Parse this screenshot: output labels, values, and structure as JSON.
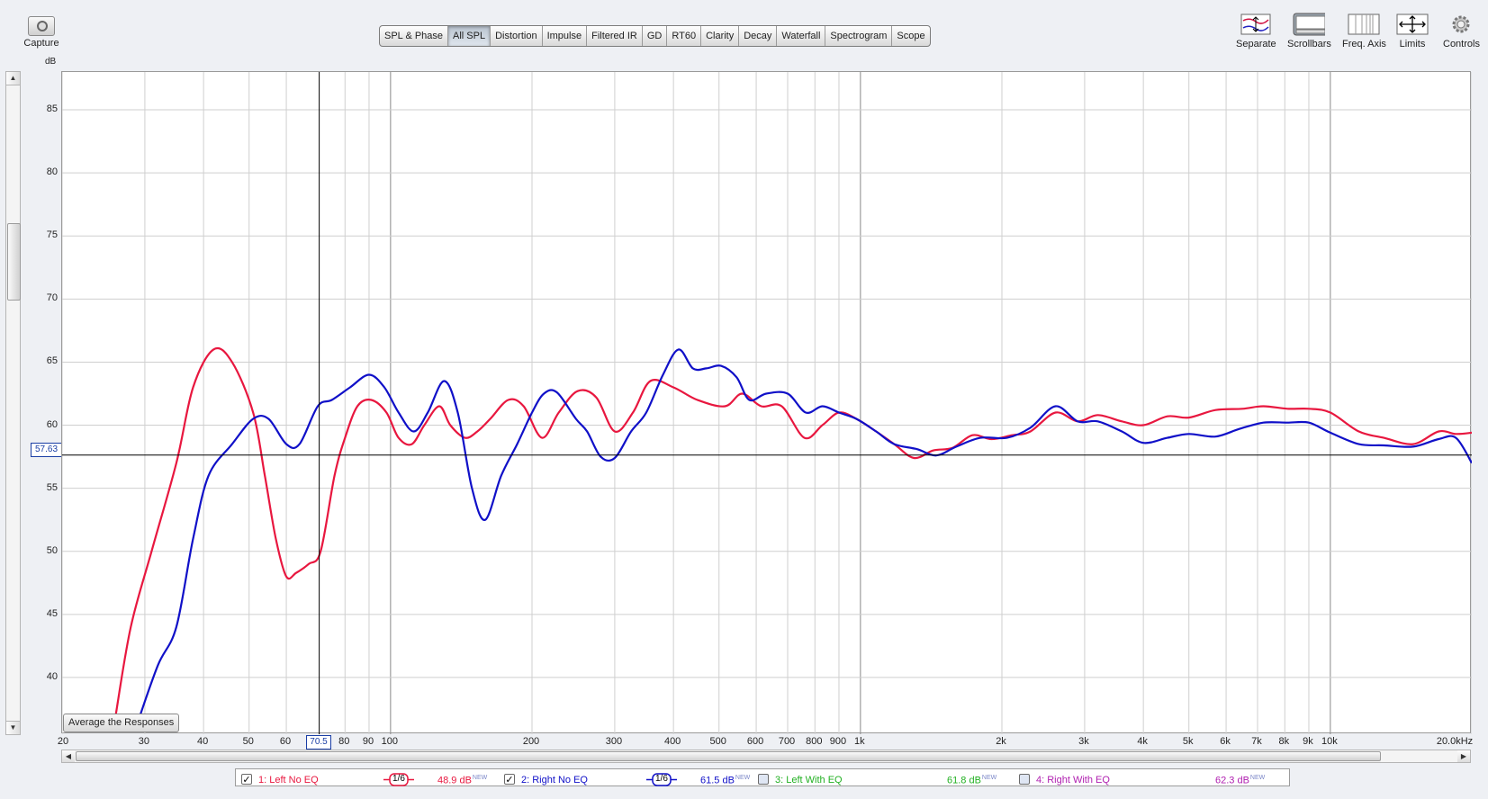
{
  "toolbar": {
    "capture_label": "Capture",
    "capture_icon": "camera-icon",
    "tabs": [
      "SPL & Phase",
      "All SPL",
      "Distortion",
      "Impulse",
      "Filtered IR",
      "GD",
      "RT60",
      "Clarity",
      "Decay",
      "Waterfall",
      "Spectrogram",
      "Scope"
    ],
    "active_tab": "All SPL",
    "right_tools": [
      {
        "label": "Separate",
        "icon": "separate-traces-icon"
      },
      {
        "label": "Scrollbars",
        "icon": "scrollbars-icon"
      },
      {
        "label": "Freq. Axis",
        "icon": "freq-axis-icon"
      },
      {
        "label": "Limits",
        "icon": "limits-icon"
      },
      {
        "label": "Controls",
        "icon": "gear-icon"
      }
    ]
  },
  "y_unit": "dB",
  "cursor": {
    "y_value": "57.63",
    "x_value": "70.5"
  },
  "average_button": "Average the Responses",
  "colors": {
    "left_no_eq": "#e8173f",
    "right_no_eq": "#1010c8",
    "left_with_eq": "#22b022",
    "right_with_eq": "#b020b0",
    "grid": "#cccccc",
    "cursor": "#000000"
  },
  "chart_data": {
    "type": "line",
    "xscale": "log",
    "xlim": [
      20,
      20000
    ],
    "ylim": [
      35.5,
      88
    ],
    "y_ticks": [
      40,
      45,
      50,
      55,
      60,
      65,
      70,
      75,
      80,
      85
    ],
    "y_tick_labels": [
      "40",
      "45",
      "50",
      "55",
      "60",
      "65",
      "70",
      "75",
      "80",
      "85"
    ],
    "x_ticks": [
      20,
      30,
      40,
      50,
      60,
      80,
      90,
      100,
      200,
      300,
      400,
      500,
      600,
      700,
      800,
      900,
      1000,
      2000,
      3000,
      4000,
      5000,
      6000,
      7000,
      8000,
      9000,
      10000,
      20000
    ],
    "x_tick_labels": [
      "20",
      "30",
      "40",
      "50",
      "60",
      "80",
      "90",
      "100",
      "200",
      "300",
      "400",
      "500",
      "600",
      "700",
      "800",
      "900",
      "1k",
      "2k",
      "3k",
      "4k",
      "5k",
      "6k",
      "7k",
      "8k",
      "9k",
      "10k",
      "20.0kHz"
    ],
    "grid": true,
    "series": [
      {
        "name": "1: Left No EQ",
        "color": "#e8173f",
        "points": [
          [
            26,
            37
          ],
          [
            28,
            44
          ],
          [
            31,
            50
          ],
          [
            35,
            57
          ],
          [
            38,
            63
          ],
          [
            42,
            66
          ],
          [
            46,
            65
          ],
          [
            51,
            61
          ],
          [
            54,
            56
          ],
          [
            57,
            51
          ],
          [
            60,
            48
          ],
          [
            63,
            48.3
          ],
          [
            67,
            49
          ],
          [
            71,
            50
          ],
          [
            76,
            56
          ],
          [
            80,
            59
          ],
          [
            85,
            61.5
          ],
          [
            91,
            62
          ],
          [
            98,
            61
          ],
          [
            104,
            59
          ],
          [
            111,
            58.5
          ],
          [
            118,
            60
          ],
          [
            127,
            61.5
          ],
          [
            134,
            60
          ],
          [
            144,
            59
          ],
          [
            153,
            59.5
          ],
          [
            163,
            60.5
          ],
          [
            178,
            62
          ],
          [
            192,
            61.5
          ],
          [
            210,
            59
          ],
          [
            228,
            61
          ],
          [
            250,
            62.7
          ],
          [
            274,
            62.2
          ],
          [
            300,
            59.5
          ],
          [
            328,
            61
          ],
          [
            357,
            63.5
          ],
          [
            400,
            63
          ],
          [
            450,
            62
          ],
          [
            515,
            61.5
          ],
          [
            560,
            62.5
          ],
          [
            615,
            61.5
          ],
          [
            680,
            61.5
          ],
          [
            760,
            59
          ],
          [
            830,
            60
          ],
          [
            900,
            61
          ],
          [
            980,
            60.5
          ],
          [
            1080,
            59.5
          ],
          [
            1180,
            58.5
          ],
          [
            1300,
            57.4
          ],
          [
            1430,
            58
          ],
          [
            1570,
            58.2
          ],
          [
            1730,
            59.2
          ],
          [
            1900,
            58.9
          ],
          [
            2100,
            59.2
          ],
          [
            2300,
            59.5
          ],
          [
            2600,
            61
          ],
          [
            2900,
            60.3
          ],
          [
            3200,
            60.8
          ],
          [
            3600,
            60.3
          ],
          [
            4000,
            60
          ],
          [
            4500,
            60.7
          ],
          [
            5000,
            60.6
          ],
          [
            5700,
            61.2
          ],
          [
            6500,
            61.3
          ],
          [
            7200,
            61.5
          ],
          [
            8100,
            61.3
          ],
          [
            9000,
            61.3
          ],
          [
            10000,
            61
          ],
          [
            11500,
            59.5
          ],
          [
            13000,
            59
          ],
          [
            15000,
            58.5
          ],
          [
            17000,
            59.5
          ],
          [
            18500,
            59.3
          ],
          [
            20000,
            59.4
          ]
        ]
      },
      {
        "name": "2: Right No EQ",
        "color": "#1010c8",
        "points": [
          [
            29,
            36.5
          ],
          [
            32,
            41
          ],
          [
            35,
            44
          ],
          [
            38,
            51
          ],
          [
            41,
            56
          ],
          [
            46,
            58.5
          ],
          [
            51,
            60.5
          ],
          [
            55,
            60.5
          ],
          [
            60,
            58.5
          ],
          [
            64,
            58.5
          ],
          [
            70,
            61.5
          ],
          [
            75,
            62
          ],
          [
            82,
            63
          ],
          [
            90,
            64
          ],
          [
            97,
            63
          ],
          [
            104,
            61
          ],
          [
            112,
            59.5
          ],
          [
            120,
            61
          ],
          [
            130,
            63.5
          ],
          [
            139,
            61
          ],
          [
            149,
            55
          ],
          [
            159,
            52.5
          ],
          [
            172,
            56
          ],
          [
            186,
            58.5
          ],
          [
            200,
            61
          ],
          [
            212,
            62.5
          ],
          [
            226,
            62.6
          ],
          [
            248,
            60.5
          ],
          [
            262,
            59.5
          ],
          [
            280,
            57.5
          ],
          [
            300,
            57.4
          ],
          [
            325,
            59.5
          ],
          [
            350,
            61
          ],
          [
            380,
            64
          ],
          [
            410,
            66
          ],
          [
            440,
            64.5
          ],
          [
            470,
            64.5
          ],
          [
            505,
            64.7
          ],
          [
            545,
            63.8
          ],
          [
            580,
            62
          ],
          [
            630,
            62.5
          ],
          [
            700,
            62.5
          ],
          [
            765,
            61
          ],
          [
            830,
            61.5
          ],
          [
            900,
            61
          ],
          [
            980,
            60.5
          ],
          [
            1080,
            59.5
          ],
          [
            1180,
            58.5
          ],
          [
            1320,
            58.1
          ],
          [
            1450,
            57.6
          ],
          [
            1600,
            58.3
          ],
          [
            1800,
            59
          ],
          [
            2050,
            59
          ],
          [
            2300,
            59.8
          ],
          [
            2600,
            61.5
          ],
          [
            2900,
            60.3
          ],
          [
            3200,
            60.3
          ],
          [
            3600,
            59.5
          ],
          [
            4000,
            58.6
          ],
          [
            4500,
            59
          ],
          [
            5000,
            59.3
          ],
          [
            5700,
            59.1
          ],
          [
            6400,
            59.7
          ],
          [
            7200,
            60.2
          ],
          [
            8100,
            60.2
          ],
          [
            9000,
            60.2
          ],
          [
            10000,
            59.4
          ],
          [
            11500,
            58.5
          ],
          [
            13000,
            58.4
          ],
          [
            15000,
            58.3
          ],
          [
            17000,
            58.9
          ],
          [
            18500,
            59
          ],
          [
            20000,
            57
          ]
        ]
      },
      {
        "name": "3: Left With EQ",
        "color": "#22b022",
        "points": []
      },
      {
        "name": "4: Right With EQ",
        "color": "#b020b0",
        "points": []
      }
    ]
  },
  "legend": [
    {
      "name": "1: Left No EQ",
      "checked": true,
      "smoothing": "1/6",
      "value": "48.9 dB",
      "tag": "NEW",
      "color": "#e8173f"
    },
    {
      "name": "2: Right No EQ",
      "checked": true,
      "smoothing": "1/6",
      "value": "61.5 dB",
      "tag": "NEW",
      "color": "#1010c8"
    },
    {
      "name": "3: Left With EQ",
      "checked": false,
      "smoothing": "",
      "value": "61.8 dB",
      "tag": "NEW",
      "color": "#22b022"
    },
    {
      "name": "4: Right With EQ",
      "checked": false,
      "smoothing": "",
      "value": "62.3 dB",
      "tag": "NEW",
      "color": "#b020b0"
    }
  ]
}
